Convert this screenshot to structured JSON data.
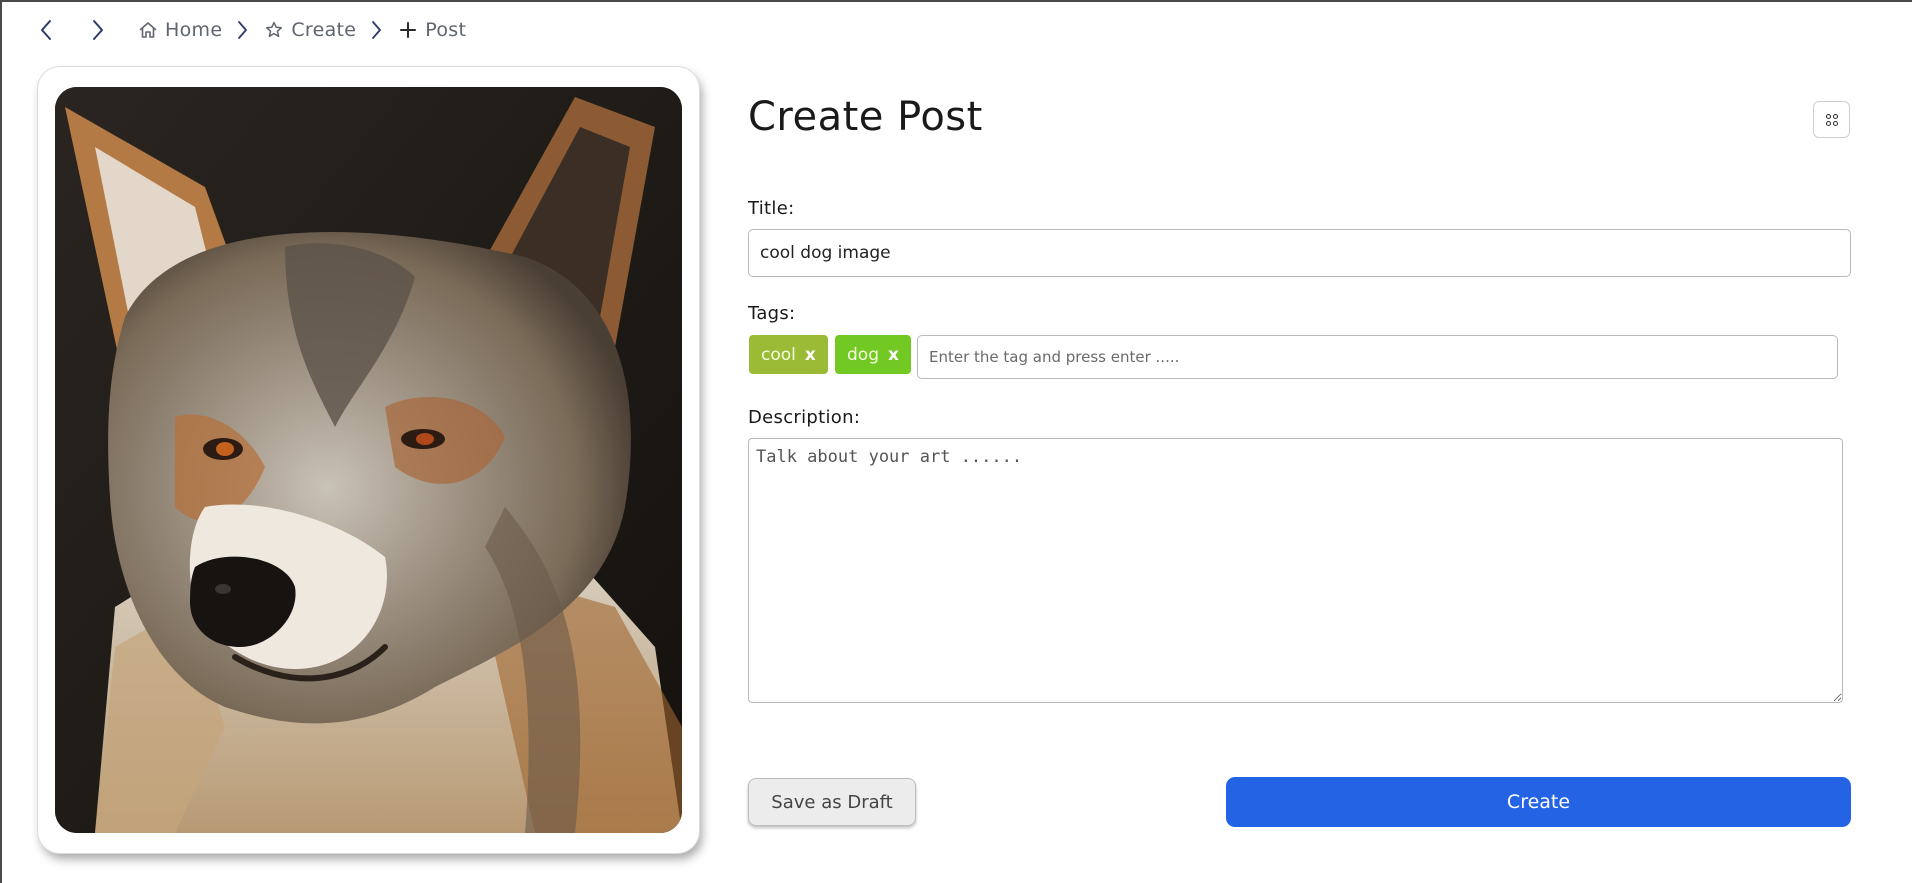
{
  "breadcrumb": {
    "items": [
      {
        "label": "Home",
        "icon": "home-icon"
      },
      {
        "label": "Create",
        "icon": "star-icon"
      },
      {
        "label": "Post",
        "icon": "plus-icon"
      }
    ]
  },
  "page": {
    "title": "Create Post"
  },
  "form": {
    "title_label": "Title:",
    "title_value": "cool dog image",
    "tags_label": "Tags:",
    "tags": [
      {
        "label": "cool",
        "remove": "x",
        "color": "#9bba35"
      },
      {
        "label": "dog",
        "remove": "x",
        "color": "#72c924"
      }
    ],
    "tag_placeholder": "Enter the tag and press enter .....",
    "description_label": "Description:",
    "description_placeholder": "Talk about your art ......",
    "draft_button": "Save as Draft",
    "create_button": "Create"
  },
  "colors": {
    "primary": "#2463e4",
    "tag_cool": "#9bba35",
    "tag_dog": "#72c924"
  }
}
